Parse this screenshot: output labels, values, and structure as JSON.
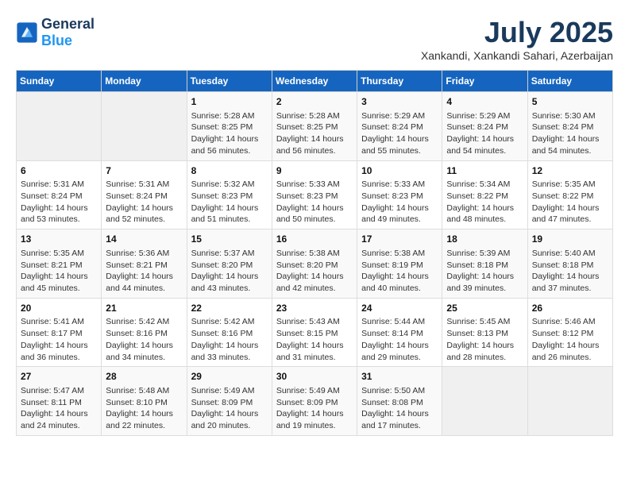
{
  "header": {
    "logo_general": "General",
    "logo_blue": "Blue",
    "month_year": "July 2025",
    "location": "Xankandi, Xankandi Sahari, Azerbaijan"
  },
  "days_of_week": [
    "Sunday",
    "Monday",
    "Tuesday",
    "Wednesday",
    "Thursday",
    "Friday",
    "Saturday"
  ],
  "weeks": [
    [
      {
        "day": "",
        "content": ""
      },
      {
        "day": "",
        "content": ""
      },
      {
        "day": "1",
        "sunrise": "5:28 AM",
        "sunset": "8:25 PM",
        "daylight": "14 hours and 56 minutes."
      },
      {
        "day": "2",
        "sunrise": "5:28 AM",
        "sunset": "8:25 PM",
        "daylight": "14 hours and 56 minutes."
      },
      {
        "day": "3",
        "sunrise": "5:29 AM",
        "sunset": "8:24 PM",
        "daylight": "14 hours and 55 minutes."
      },
      {
        "day": "4",
        "sunrise": "5:29 AM",
        "sunset": "8:24 PM",
        "daylight": "14 hours and 54 minutes."
      },
      {
        "day": "5",
        "sunrise": "5:30 AM",
        "sunset": "8:24 PM",
        "daylight": "14 hours and 54 minutes."
      }
    ],
    [
      {
        "day": "6",
        "sunrise": "5:31 AM",
        "sunset": "8:24 PM",
        "daylight": "14 hours and 53 minutes."
      },
      {
        "day": "7",
        "sunrise": "5:31 AM",
        "sunset": "8:24 PM",
        "daylight": "14 hours and 52 minutes."
      },
      {
        "day": "8",
        "sunrise": "5:32 AM",
        "sunset": "8:23 PM",
        "daylight": "14 hours and 51 minutes."
      },
      {
        "day": "9",
        "sunrise": "5:33 AM",
        "sunset": "8:23 PM",
        "daylight": "14 hours and 50 minutes."
      },
      {
        "day": "10",
        "sunrise": "5:33 AM",
        "sunset": "8:23 PM",
        "daylight": "14 hours and 49 minutes."
      },
      {
        "day": "11",
        "sunrise": "5:34 AM",
        "sunset": "8:22 PM",
        "daylight": "14 hours and 48 minutes."
      },
      {
        "day": "12",
        "sunrise": "5:35 AM",
        "sunset": "8:22 PM",
        "daylight": "14 hours and 47 minutes."
      }
    ],
    [
      {
        "day": "13",
        "sunrise": "5:35 AM",
        "sunset": "8:21 PM",
        "daylight": "14 hours and 45 minutes."
      },
      {
        "day": "14",
        "sunrise": "5:36 AM",
        "sunset": "8:21 PM",
        "daylight": "14 hours and 44 minutes."
      },
      {
        "day": "15",
        "sunrise": "5:37 AM",
        "sunset": "8:20 PM",
        "daylight": "14 hours and 43 minutes."
      },
      {
        "day": "16",
        "sunrise": "5:38 AM",
        "sunset": "8:20 PM",
        "daylight": "14 hours and 42 minutes."
      },
      {
        "day": "17",
        "sunrise": "5:38 AM",
        "sunset": "8:19 PM",
        "daylight": "14 hours and 40 minutes."
      },
      {
        "day": "18",
        "sunrise": "5:39 AM",
        "sunset": "8:18 PM",
        "daylight": "14 hours and 39 minutes."
      },
      {
        "day": "19",
        "sunrise": "5:40 AM",
        "sunset": "8:18 PM",
        "daylight": "14 hours and 37 minutes."
      }
    ],
    [
      {
        "day": "20",
        "sunrise": "5:41 AM",
        "sunset": "8:17 PM",
        "daylight": "14 hours and 36 minutes."
      },
      {
        "day": "21",
        "sunrise": "5:42 AM",
        "sunset": "8:16 PM",
        "daylight": "14 hours and 34 minutes."
      },
      {
        "day": "22",
        "sunrise": "5:42 AM",
        "sunset": "8:16 PM",
        "daylight": "14 hours and 33 minutes."
      },
      {
        "day": "23",
        "sunrise": "5:43 AM",
        "sunset": "8:15 PM",
        "daylight": "14 hours and 31 minutes."
      },
      {
        "day": "24",
        "sunrise": "5:44 AM",
        "sunset": "8:14 PM",
        "daylight": "14 hours and 29 minutes."
      },
      {
        "day": "25",
        "sunrise": "5:45 AM",
        "sunset": "8:13 PM",
        "daylight": "14 hours and 28 minutes."
      },
      {
        "day": "26",
        "sunrise": "5:46 AM",
        "sunset": "8:12 PM",
        "daylight": "14 hours and 26 minutes."
      }
    ],
    [
      {
        "day": "27",
        "sunrise": "5:47 AM",
        "sunset": "8:11 PM",
        "daylight": "14 hours and 24 minutes."
      },
      {
        "day": "28",
        "sunrise": "5:48 AM",
        "sunset": "8:10 PM",
        "daylight": "14 hours and 22 minutes."
      },
      {
        "day": "29",
        "sunrise": "5:49 AM",
        "sunset": "8:09 PM",
        "daylight": "14 hours and 20 minutes."
      },
      {
        "day": "30",
        "sunrise": "5:49 AM",
        "sunset": "8:09 PM",
        "daylight": "14 hours and 19 minutes."
      },
      {
        "day": "31",
        "sunrise": "5:50 AM",
        "sunset": "8:08 PM",
        "daylight": "14 hours and 17 minutes."
      },
      {
        "day": "",
        "content": ""
      },
      {
        "day": "",
        "content": ""
      }
    ]
  ],
  "labels": {
    "sunrise": "Sunrise:",
    "sunset": "Sunset:",
    "daylight": "Daylight:"
  }
}
